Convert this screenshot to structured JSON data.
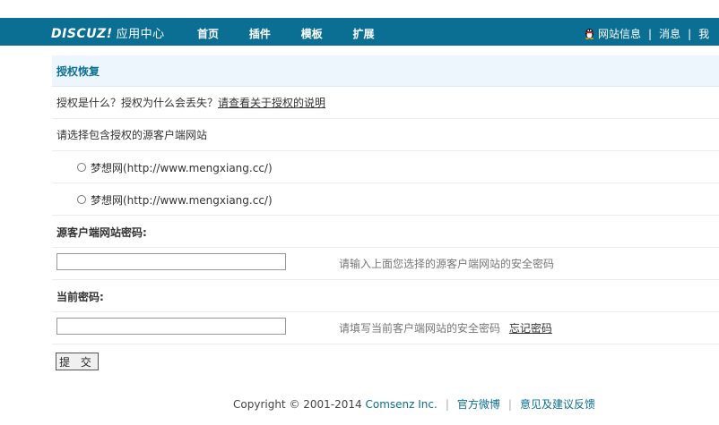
{
  "header": {
    "logo": "DISCUZ!",
    "app_name": "应用中心",
    "nav": [
      "首页",
      "插件",
      "模板",
      "扩展"
    ],
    "user_links": [
      "网站信息",
      "消息",
      "我"
    ]
  },
  "form": {
    "section_title": "授权恢复",
    "intro_question": "授权是什么？授权为什么会丢失？",
    "intro_link": "请查看关于授权的说明",
    "choose_label": "请选择包含授权的源客户端网站",
    "sites": [
      "梦想网(http://www.mengxiang.cc/)",
      "梦想网(http://www.mengxiang.cc/)"
    ],
    "source_password_label": "源客户端网站密码:",
    "source_password_value": "",
    "source_password_hint": "请输入上面您选择的源客户端网站的安全密码",
    "current_password_label": "当前密码:",
    "current_password_value": "",
    "current_password_hint": "请填写当前客户端网站的安全密码",
    "forgot_password": "忘记密码",
    "submit": "提 交"
  },
  "footer": {
    "copyright": "Copyright © 2001-2014",
    "company": "Comsenz Inc.",
    "weibo": "官方微博",
    "feedback": "意见及建议反馈"
  },
  "colors": {
    "header_bg": "#0b6f94",
    "section_bg": "#eef6fd",
    "link_blue": "#0b6f94"
  },
  "icons": {
    "user_icon": "qq-penguin-icon"
  }
}
